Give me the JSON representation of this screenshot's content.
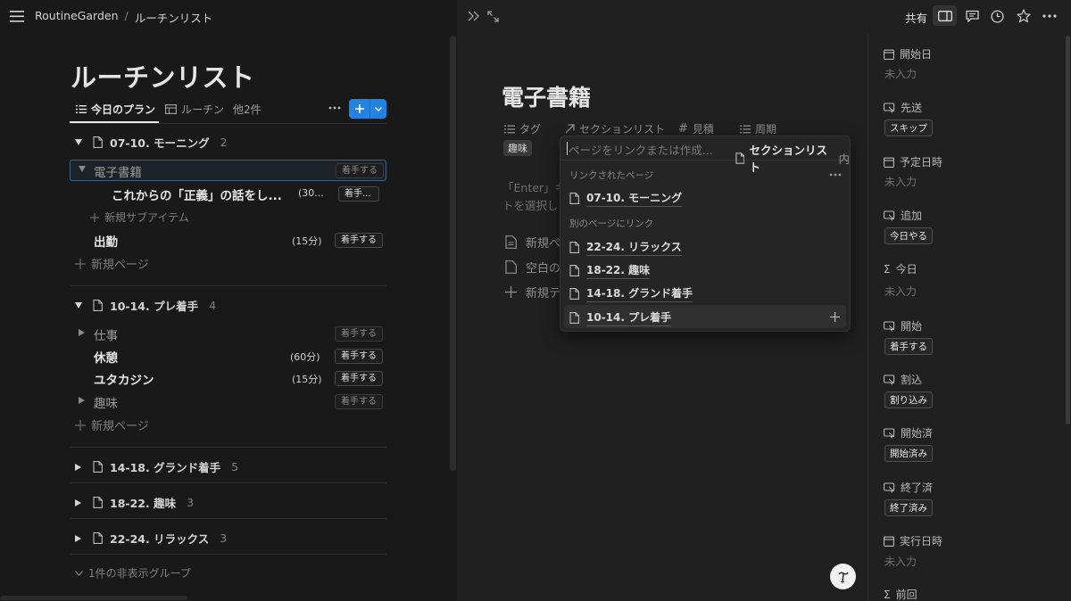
{
  "breadcrumb": {
    "workspace": "RoutineGarden",
    "sep": "/",
    "page": "ルーチンリスト"
  },
  "left": {
    "title": "ルーチンリスト",
    "tabs": [
      {
        "label": "今日のプラン",
        "icon": "list-icon"
      },
      {
        "label": "ルーチン",
        "icon": "table-icon"
      },
      {
        "label": "他2件"
      }
    ],
    "groups": [
      {
        "title": "07-10. モーニング",
        "count": "2"
      },
      {
        "title": "10-14. プレ着手",
        "count": "4"
      },
      {
        "title": "14-18. グランド着手",
        "count": "5"
      },
      {
        "title": "18-22. 趣味",
        "count": "3"
      },
      {
        "title": "22-24. リラックス",
        "count": "3"
      }
    ],
    "rows": {
      "ebook": {
        "title": "電子書籍",
        "action": "着手する"
      },
      "ebook_child": {
        "title": "これからの「正義」の話をし...",
        "dur": "(30...",
        "action": "着手..."
      },
      "new_sub": "新規サブアイテム",
      "commute": {
        "title": "出勤",
        "dur": "(15分)",
        "action": "着手する"
      },
      "new_page": "新規ページ",
      "work": {
        "title": "仕事",
        "action": "着手する"
      },
      "rest": {
        "title": "休憩",
        "dur": "(60分)",
        "action": "着手する"
      },
      "yutakajin": {
        "title": "ユタカジン",
        "dur": "(15分)",
        "action": "着手する"
      },
      "hobby": {
        "title": "趣味",
        "action": "着手する"
      }
    },
    "hidden_groups": "1件の非表示グループ"
  },
  "topbar": {
    "share": "共有"
  },
  "doc": {
    "title": "電子書籍",
    "props": {
      "tag": "タグ",
      "section": "セクションリスト",
      "estimate": "見積",
      "cycle": "周期"
    },
    "tag_value": "趣味",
    "hint_line1": "「Enter」キ",
    "hint_line2": "トを選択し",
    "items": [
      {
        "label": "新規ペ",
        "icon": "doc-lines-icon"
      },
      {
        "label": "空白の",
        "icon": "doc-icon"
      },
      {
        "label": "新規テ",
        "icon": "plus-icon"
      }
    ]
  },
  "popup": {
    "placeholder": "ページをリンクまたは作成...",
    "target_label": "セクションリスト",
    "target_suffix": "内",
    "linked_header": "リンクされたページ",
    "linked": [
      "07-10. モーニング"
    ],
    "other_header": "別のページにリンク",
    "others": [
      "22-24. リラックス",
      "18-22. 趣味",
      "14-18. グランド着手",
      "10-14. プレ着手"
    ]
  },
  "side": [
    {
      "label": "開始日",
      "empty": "未入力"
    },
    {
      "label": "先送",
      "pill": "スキップ"
    },
    {
      "label": "予定日時",
      "empty": "未入力"
    },
    {
      "label": "追加",
      "pill": "今日やる"
    },
    {
      "label": "今日",
      "empty": "未入力"
    },
    {
      "label": "開始",
      "pill": "着手する"
    },
    {
      "label": "割込",
      "pill": "割り込み"
    },
    {
      "label": "開始済",
      "pill": "開始済み"
    },
    {
      "label": "終了済",
      "pill": "終了済み"
    },
    {
      "label": "実行日時",
      "empty": "未入力"
    },
    {
      "label": "前回"
    }
  ],
  "colors": {
    "bg_left": "#191919",
    "bg_right": "#202020",
    "accent": "#2383e2"
  }
}
